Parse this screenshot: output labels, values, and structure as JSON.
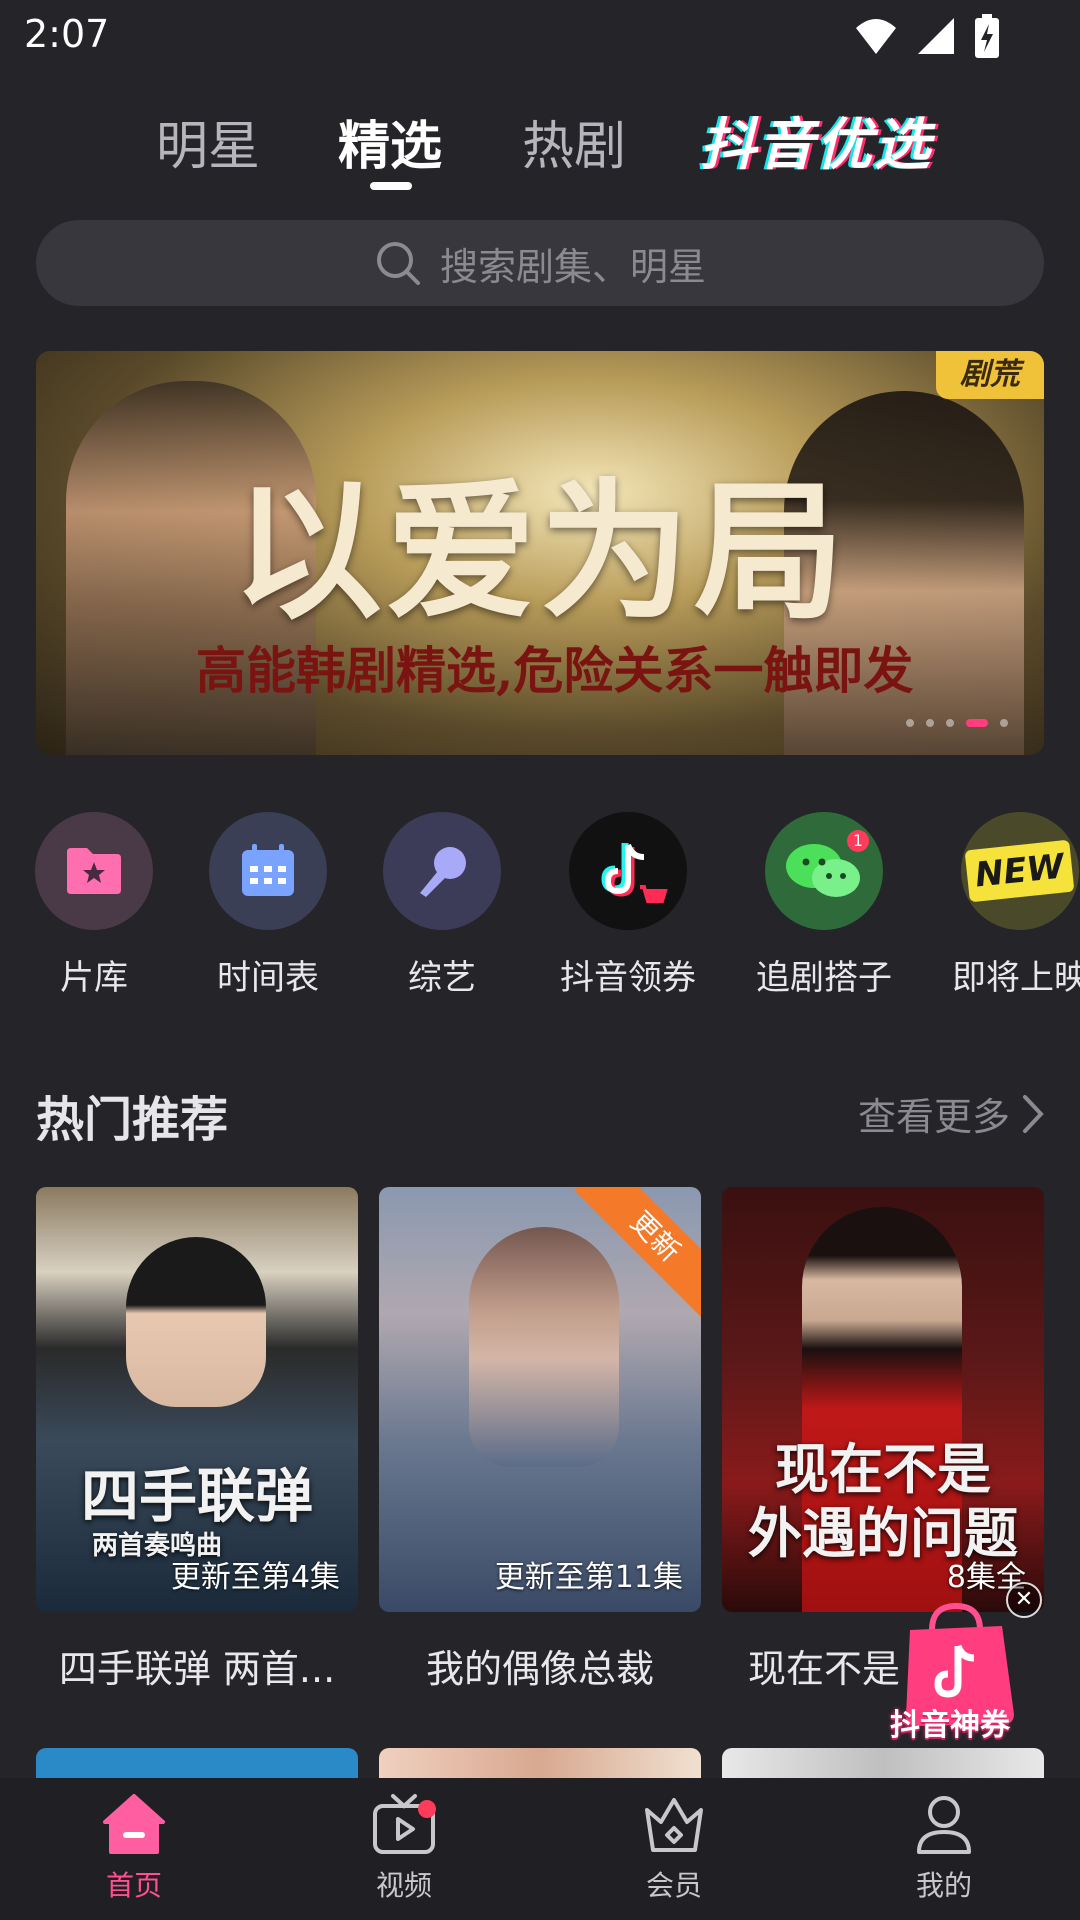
{
  "status_bar": {
    "time": "2:07"
  },
  "top_tabs": {
    "tabs": [
      "明星",
      "精选",
      "热剧"
    ],
    "active": "精选",
    "douyin_logo": "抖音优选"
  },
  "search": {
    "placeholder": "搜索剧集、明星"
  },
  "banner": {
    "title": "以爱为局",
    "subtitle": "高能韩剧精选,危险关系一触即发",
    "tag": "剧荒",
    "page_count": 5,
    "active_page": 4
  },
  "quick_entries": [
    {
      "label": "片库",
      "icon": "folder-star-icon"
    },
    {
      "label": "时间表",
      "icon": "calendar-icon"
    },
    {
      "label": "综艺",
      "icon": "microphone-icon"
    },
    {
      "label": "抖音领券",
      "icon": "douyin-cart-icon"
    },
    {
      "label": "追剧搭子",
      "icon": "wechat-icon",
      "badge": "1"
    },
    {
      "label": "即将上映",
      "icon": "new-badge-icon",
      "badge_text": "NEW"
    }
  ],
  "section": {
    "title": "热门推荐",
    "more": "查看更多"
  },
  "cards": [
    {
      "title": "四手联弹 两首...",
      "caption": "更新至第4集",
      "poster_text": "四手联弹",
      "poster_subtext": "两首奏鸣曲"
    },
    {
      "title": "我的偶像总裁",
      "caption": "更新至第11集",
      "ribbon": "更新"
    },
    {
      "title": "现在不是",
      "caption": "8集全",
      "poster_text_line1": "现在不是",
      "poster_text_line2": "外遇的问题"
    }
  ],
  "coupon": {
    "label": "抖音神券"
  },
  "bottom_nav": [
    {
      "label": "首页",
      "icon": "home-icon",
      "active": true
    },
    {
      "label": "视频",
      "icon": "tv-icon",
      "dot": true
    },
    {
      "label": "会员",
      "icon": "crown-icon"
    },
    {
      "label": "我的",
      "icon": "person-icon"
    }
  ],
  "colors": {
    "accent": "#ff4f8f",
    "background": "#242429",
    "search_bg": "#37373d"
  }
}
